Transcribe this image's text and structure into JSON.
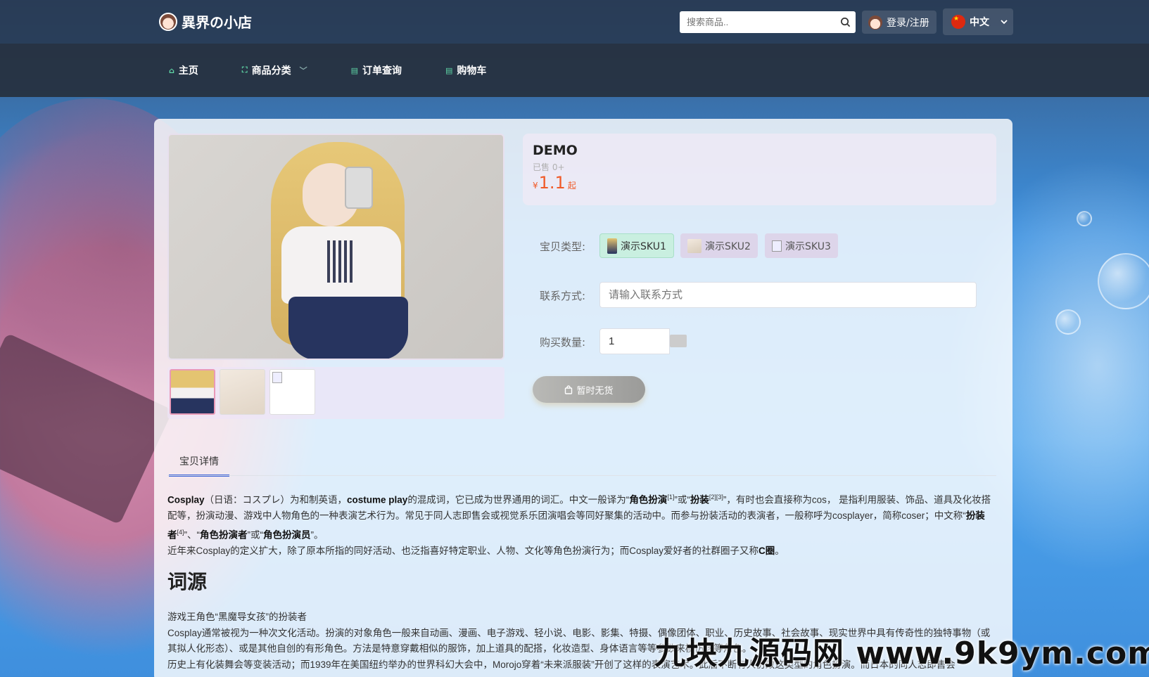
{
  "header": {
    "logo_text": "異界の小店",
    "search_placeholder": "搜索商品..",
    "login_label": "登录/注册",
    "language": "中文"
  },
  "nav": {
    "items": [
      {
        "label": "主页",
        "icon": "home-icon"
      },
      {
        "label": "商品分类",
        "icon": "grid-icon",
        "has_dropdown": true
      },
      {
        "label": "订单查询",
        "icon": "order-icon"
      },
      {
        "label": "购物车",
        "icon": "cart-icon"
      }
    ]
  },
  "product": {
    "title": "DEMO",
    "sold": "已售 0+",
    "price_symbol": "¥",
    "price": "1.1",
    "price_suffix": "起",
    "sku_label": "宝贝类型:",
    "skus": [
      {
        "label": "演示SKU1",
        "selected": true
      },
      {
        "label": "演示SKU2",
        "selected": false
      },
      {
        "label": "演示SKU3",
        "selected": false
      }
    ],
    "contact_label": "联系方式:",
    "contact_placeholder": "请输入联系方式",
    "qty_label": "购买数量:",
    "qty_value": "1",
    "buy_label": "暂时无货"
  },
  "detail": {
    "tab_label": "宝贝详情",
    "p1_a": "Cosplay",
    "p1_b": "（日语：コスプレ）为和制英语，",
    "p1_c": "costume play",
    "p1_d": "的混成词，它已成为世界通用的词汇。中文一般译为“",
    "p1_e": "角色扮演",
    "p1_f": "[1]",
    "p1_g": "”或“",
    "p1_h": "扮装",
    "p1_i": "[2][3]",
    "p1_j": "”，有时也会直接称为cos， 是指利用服装、饰品、道具及化妆搭配等，扮演动漫、游戏中人物角色的一种表演艺术行为。常见于同人志即售会或视觉系乐团演唱会等同好聚集的活动中。而参与扮装活动的表演者，一般称呼为cosplayer，简称coser；中文称“",
    "p1_k": "扮装者",
    "p1_l": "[4]",
    "p1_m": "”、“",
    "p1_n": "角色扮演者",
    "p1_o": "”或“",
    "p1_p": "角色扮演员",
    "p1_q": "”。",
    "p2_a": "近年来Cosplay的定义扩大，除了原本所指的同好活动、也泛指喜好特定职业、人物、文化等角色扮演行为；而Cosplay爱好者的社群圈子又称",
    "p2_b": "C圈",
    "p2_c": "。",
    "heading": "词源",
    "caption": "游戏王角色“黑魔导女孩”的扮装者",
    "p3": "Cosplay通常被视为一种次文化活动。扮演的对象角色一般来自动画、漫画、电子游戏、轻小说、电影、影集、特摄、偶像团体、职业、历史故事、社会故事、现实世界中具有传奇性的独特事物（或其拟人化形态）、或是其他自创的有形角色。方法是特意穿戴相似的服饰，加上道具的配搭，化妆造型、身体语言等等参数来模仿该等角色。",
    "p4": "历史上有化装舞会等变装活动；而1939年在美国纽约举办的世界科幻大会中，Morojo穿着“未来派服装”开创了这样的表演艺术。此后不断有人仿效这类型的角色扮演。而日本的同人志即售会"
  },
  "watermark": "九块九源码网 www.9k9ym.com"
}
